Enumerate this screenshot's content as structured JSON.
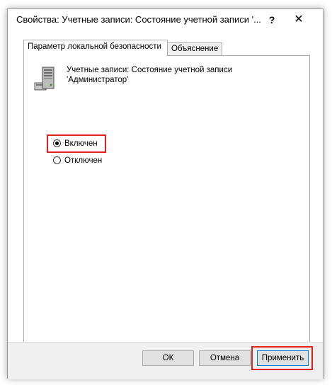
{
  "window": {
    "title": "Свойства: Учетные записи: Состояние учетной записи '...",
    "help_label": "?",
    "close_label": "✕"
  },
  "tabs": [
    {
      "label": "Параметр локальной безопасности",
      "active": true
    },
    {
      "label": "Объяснение",
      "active": false
    }
  ],
  "policy": {
    "icon": "server-policy-icon",
    "title_line1": "Учетные записи: Состояние учетной записи",
    "title_line2": "'Администратор'"
  },
  "options": [
    {
      "label": "Включен",
      "checked": true
    },
    {
      "label": "Отключен",
      "checked": false
    }
  ],
  "buttons": {
    "ok": "ОК",
    "cancel": "Отмена",
    "apply": "Применить"
  },
  "colors": {
    "highlight": "#e0201b",
    "accent": "#0078d7"
  }
}
